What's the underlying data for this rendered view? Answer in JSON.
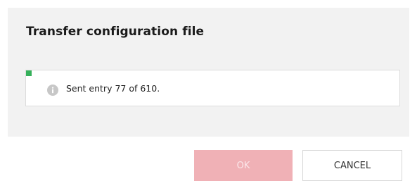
{
  "dialog": {
    "title": "Transfer configuration file",
    "status_text": "Sent entry 77 of 610.",
    "status_icon": "info-icon",
    "progress": {
      "current": 77,
      "total": 610,
      "fraction": 0.126
    },
    "colors": {
      "progress_fill": "#35b05a",
      "ok_button": "#f0b1b6",
      "panel_background": "#f2f2f2"
    }
  },
  "buttons": {
    "ok_label": "OK",
    "cancel_label": "CANCEL"
  }
}
